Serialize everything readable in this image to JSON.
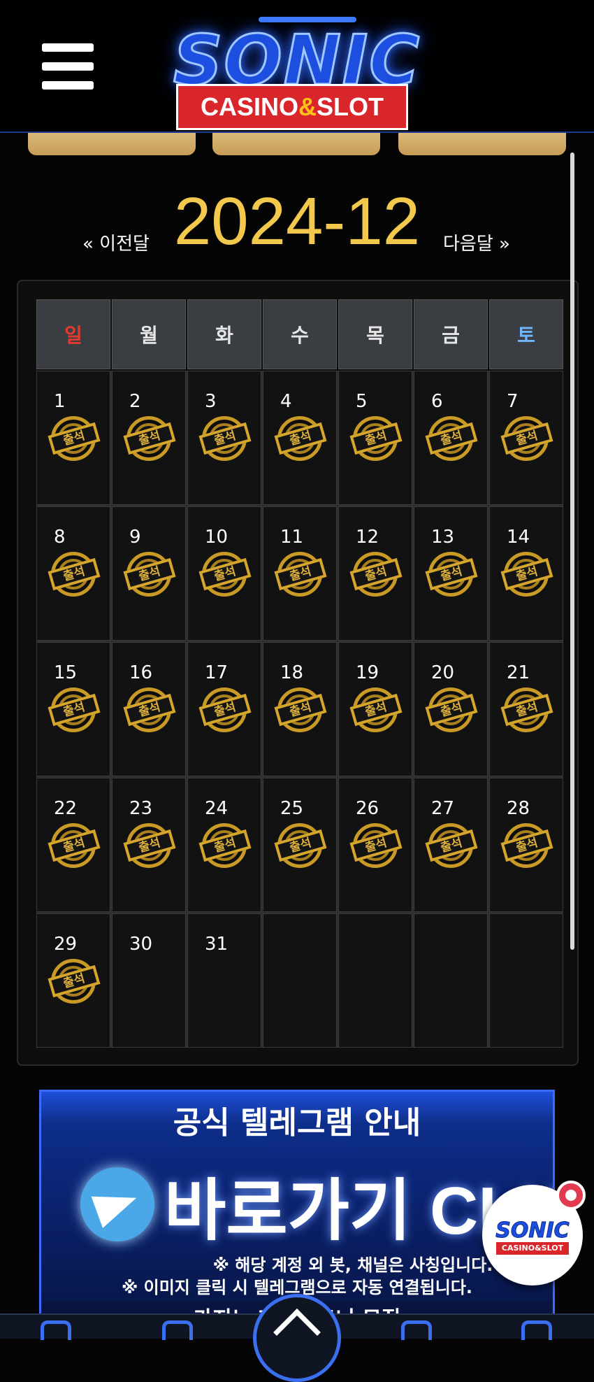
{
  "header": {
    "logo_main": "SONIC",
    "logo_sub_left": "CASINO",
    "logo_sub_amp": "&",
    "logo_sub_right": "SLOT"
  },
  "calendar": {
    "prev_label": "« 이전달",
    "next_label": "다음달 »",
    "month": "2024-12",
    "weekdays": [
      "일",
      "월",
      "화",
      "수",
      "목",
      "금",
      "토"
    ],
    "stamp_label": "출석",
    "days": [
      {
        "n": "1",
        "s": true
      },
      {
        "n": "2",
        "s": true
      },
      {
        "n": "3",
        "s": true
      },
      {
        "n": "4",
        "s": true
      },
      {
        "n": "5",
        "s": true
      },
      {
        "n": "6",
        "s": true
      },
      {
        "n": "7",
        "s": true
      },
      {
        "n": "8",
        "s": true
      },
      {
        "n": "9",
        "s": true
      },
      {
        "n": "10",
        "s": true
      },
      {
        "n": "11",
        "s": true
      },
      {
        "n": "12",
        "s": true
      },
      {
        "n": "13",
        "s": true
      },
      {
        "n": "14",
        "s": true
      },
      {
        "n": "15",
        "s": true
      },
      {
        "n": "16",
        "s": true
      },
      {
        "n": "17",
        "s": true
      },
      {
        "n": "18",
        "s": true
      },
      {
        "n": "19",
        "s": true
      },
      {
        "n": "20",
        "s": true
      },
      {
        "n": "21",
        "s": true
      },
      {
        "n": "22",
        "s": true
      },
      {
        "n": "23",
        "s": true
      },
      {
        "n": "24",
        "s": true
      },
      {
        "n": "25",
        "s": true
      },
      {
        "n": "26",
        "s": true
      },
      {
        "n": "27",
        "s": true
      },
      {
        "n": "28",
        "s": true
      },
      {
        "n": "29",
        "s": true
      },
      {
        "n": "30",
        "s": false
      },
      {
        "n": "31",
        "s": false
      },
      {
        "n": "",
        "s": false
      },
      {
        "n": "",
        "s": false
      },
      {
        "n": "",
        "s": false
      },
      {
        "n": "",
        "s": false
      }
    ]
  },
  "banner": {
    "title": "공식 텔레그램 안내",
    "cta": "바로가기 CLICK",
    "note1": "※ 해당 계정 외 봇, 채널은 사칭입니다.",
    "note2": "※ 이미지 클릭 시 텔레그램으로 자동 연결됩니다.",
    "recruit": "카지노 제휴파트너 모집"
  },
  "floating": {
    "logo_main": "SONIC",
    "logo_sub": "CASINO&SLOT"
  },
  "icons": [
    "menu-icon",
    "telegram-icon",
    "close-icon",
    "home-icon"
  ],
  "colors": {
    "accent_gold": "#f2c94c",
    "sunday": "#e23b2e",
    "saturday": "#6fb6ff",
    "brand_blue": "#1c4fe0"
  }
}
